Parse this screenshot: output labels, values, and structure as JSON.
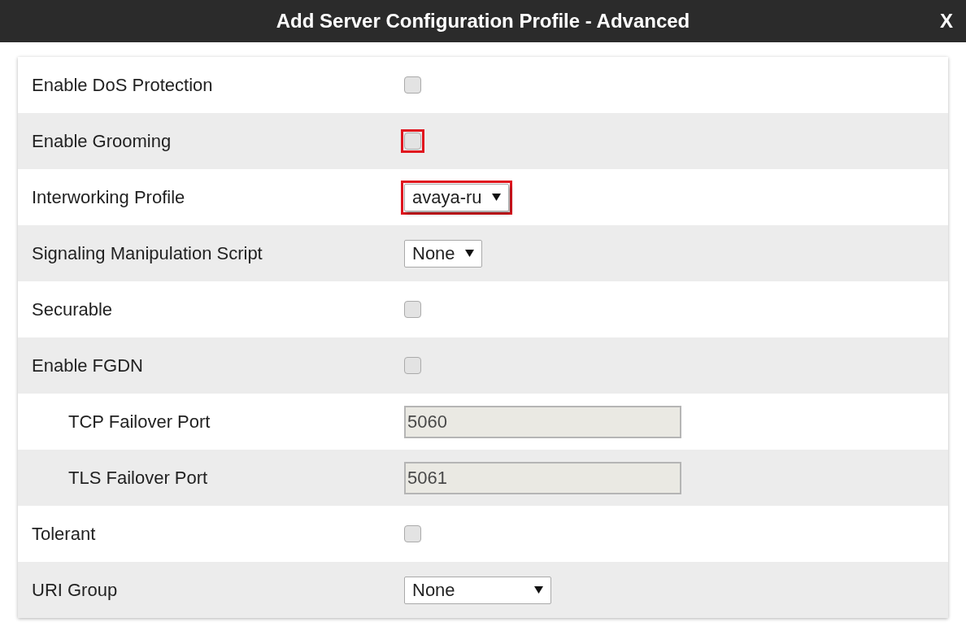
{
  "window": {
    "title": "Add Server Configuration Profile - Advanced",
    "close": "X"
  },
  "rows": [
    {
      "label": "Enable DoS Protection",
      "kind": "checkbox",
      "checked": false,
      "highlighted": false
    },
    {
      "label": "Enable Grooming",
      "kind": "checkbox",
      "checked": false,
      "highlighted": true
    },
    {
      "label": "Interworking Profile",
      "kind": "select",
      "value": "avaya-ru",
      "highlighted": true
    },
    {
      "label": "Signaling Manipulation Script",
      "kind": "select",
      "value": "None",
      "highlighted": false
    },
    {
      "label": "Securable",
      "kind": "checkbox",
      "checked": false,
      "highlighted": false
    },
    {
      "label": "Enable FGDN",
      "kind": "checkbox",
      "checked": false,
      "highlighted": false,
      "children": [
        {
          "label": "TCP Failover Port",
          "kind": "text",
          "value": "5060",
          "disabled": true,
          "highlighted": false
        },
        {
          "label": "TLS Failover Port",
          "kind": "text",
          "value": "5061",
          "disabled": true,
          "highlighted": false
        }
      ]
    },
    {
      "label": "Tolerant",
      "kind": "checkbox",
      "checked": false,
      "highlighted": false
    },
    {
      "label": "URI Group",
      "kind": "select",
      "value": "None",
      "wide": true,
      "highlighted": false
    }
  ]
}
